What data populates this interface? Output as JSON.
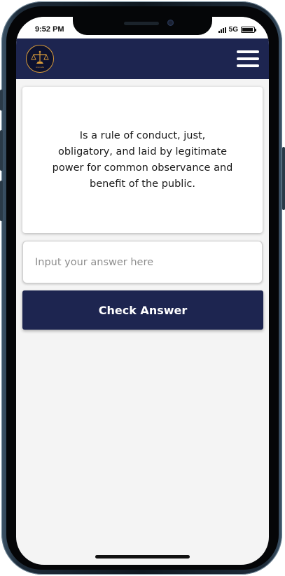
{
  "status_bar": {
    "time": "9:52 PM",
    "network": "5G"
  },
  "header": {
    "logo_icon": "scales-of-justice-logo",
    "logo_text": "Araneta",
    "menu_icon": "hamburger-menu-icon"
  },
  "question": {
    "text": "Is a rule of conduct, just, obligatory, and laid by legitimate power for common observance and benefit of the public."
  },
  "answer": {
    "placeholder": "Input your answer here",
    "value": ""
  },
  "actions": {
    "check_label": "Check Answer"
  },
  "colors": {
    "primary": "#1d2550",
    "logo_accent": "#d89b3a",
    "background": "#f4f4f4"
  }
}
